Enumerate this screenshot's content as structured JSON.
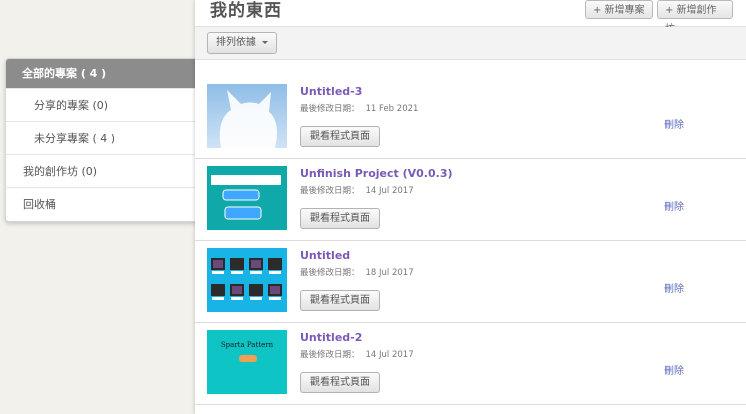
{
  "header": {
    "title": "我的東西",
    "new_project_label": "+ 新增專案",
    "new_studio_label": "+ 新增創作坊"
  },
  "toolbar": {
    "sort_label": "排列依據"
  },
  "sidebar": {
    "items": [
      {
        "label": "全部的專案 ( 4 )",
        "active": true
      },
      {
        "label": "分享的專案 (0)"
      },
      {
        "label": "未分享專案 ( 4 )"
      },
      {
        "label": "我的創作坊 (0)"
      },
      {
        "label": "回收桶"
      }
    ]
  },
  "projects": [
    {
      "title": "Untitled-3",
      "date_label": "最後修改日期：",
      "date": "11 Feb 2021",
      "view_label": "觀看程式頁面",
      "delete_label": "刪除",
      "thumb": "cat-icon"
    },
    {
      "title": "Unfinish Project (V0.0.3)",
      "date_label": "最後修改日期：",
      "date": "14 Jul 2017",
      "view_label": "觀看程式頁面",
      "delete_label": "刪除",
      "thumb": "teal-ui"
    },
    {
      "title": "Untitled",
      "date_label": "最後修改日期：",
      "date": "18 Jul 2017",
      "view_label": "觀看程式頁面",
      "delete_label": "刪除",
      "thumb": "grid-ui"
    },
    {
      "title": "Untitled-2",
      "date_label": "最後修改日期：",
      "date": "14 Jul 2017",
      "view_label": "觀看程式頁面",
      "delete_label": "刪除",
      "thumb": "sparta-ui",
      "thumb_text": "Sparta Pattern"
    }
  ],
  "colors": {
    "accent": "#7a5ab5",
    "link": "#5c6bbf",
    "active_sidebar": "#8c8c8c",
    "thumb_teal": "#0fb3b3"
  }
}
